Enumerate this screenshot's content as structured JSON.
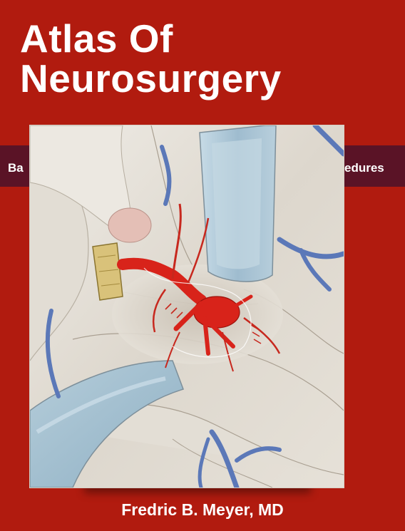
{
  "cover": {
    "title_line1": "Atlas Of",
    "title_line2": "Neurosurgery",
    "band_left_text": "Ba",
    "band_right_text": "edures",
    "author": "Fredric B. Meyer, MD"
  },
  "colors": {
    "background": "#b11b0f",
    "band": "#5a1326",
    "text": "#ffffff",
    "artery": "#d8231a",
    "vein": "#5b78b8",
    "retractor": "#a9c4d6"
  },
  "illustration": {
    "icon": "surgical-aneurysm-illustration"
  }
}
